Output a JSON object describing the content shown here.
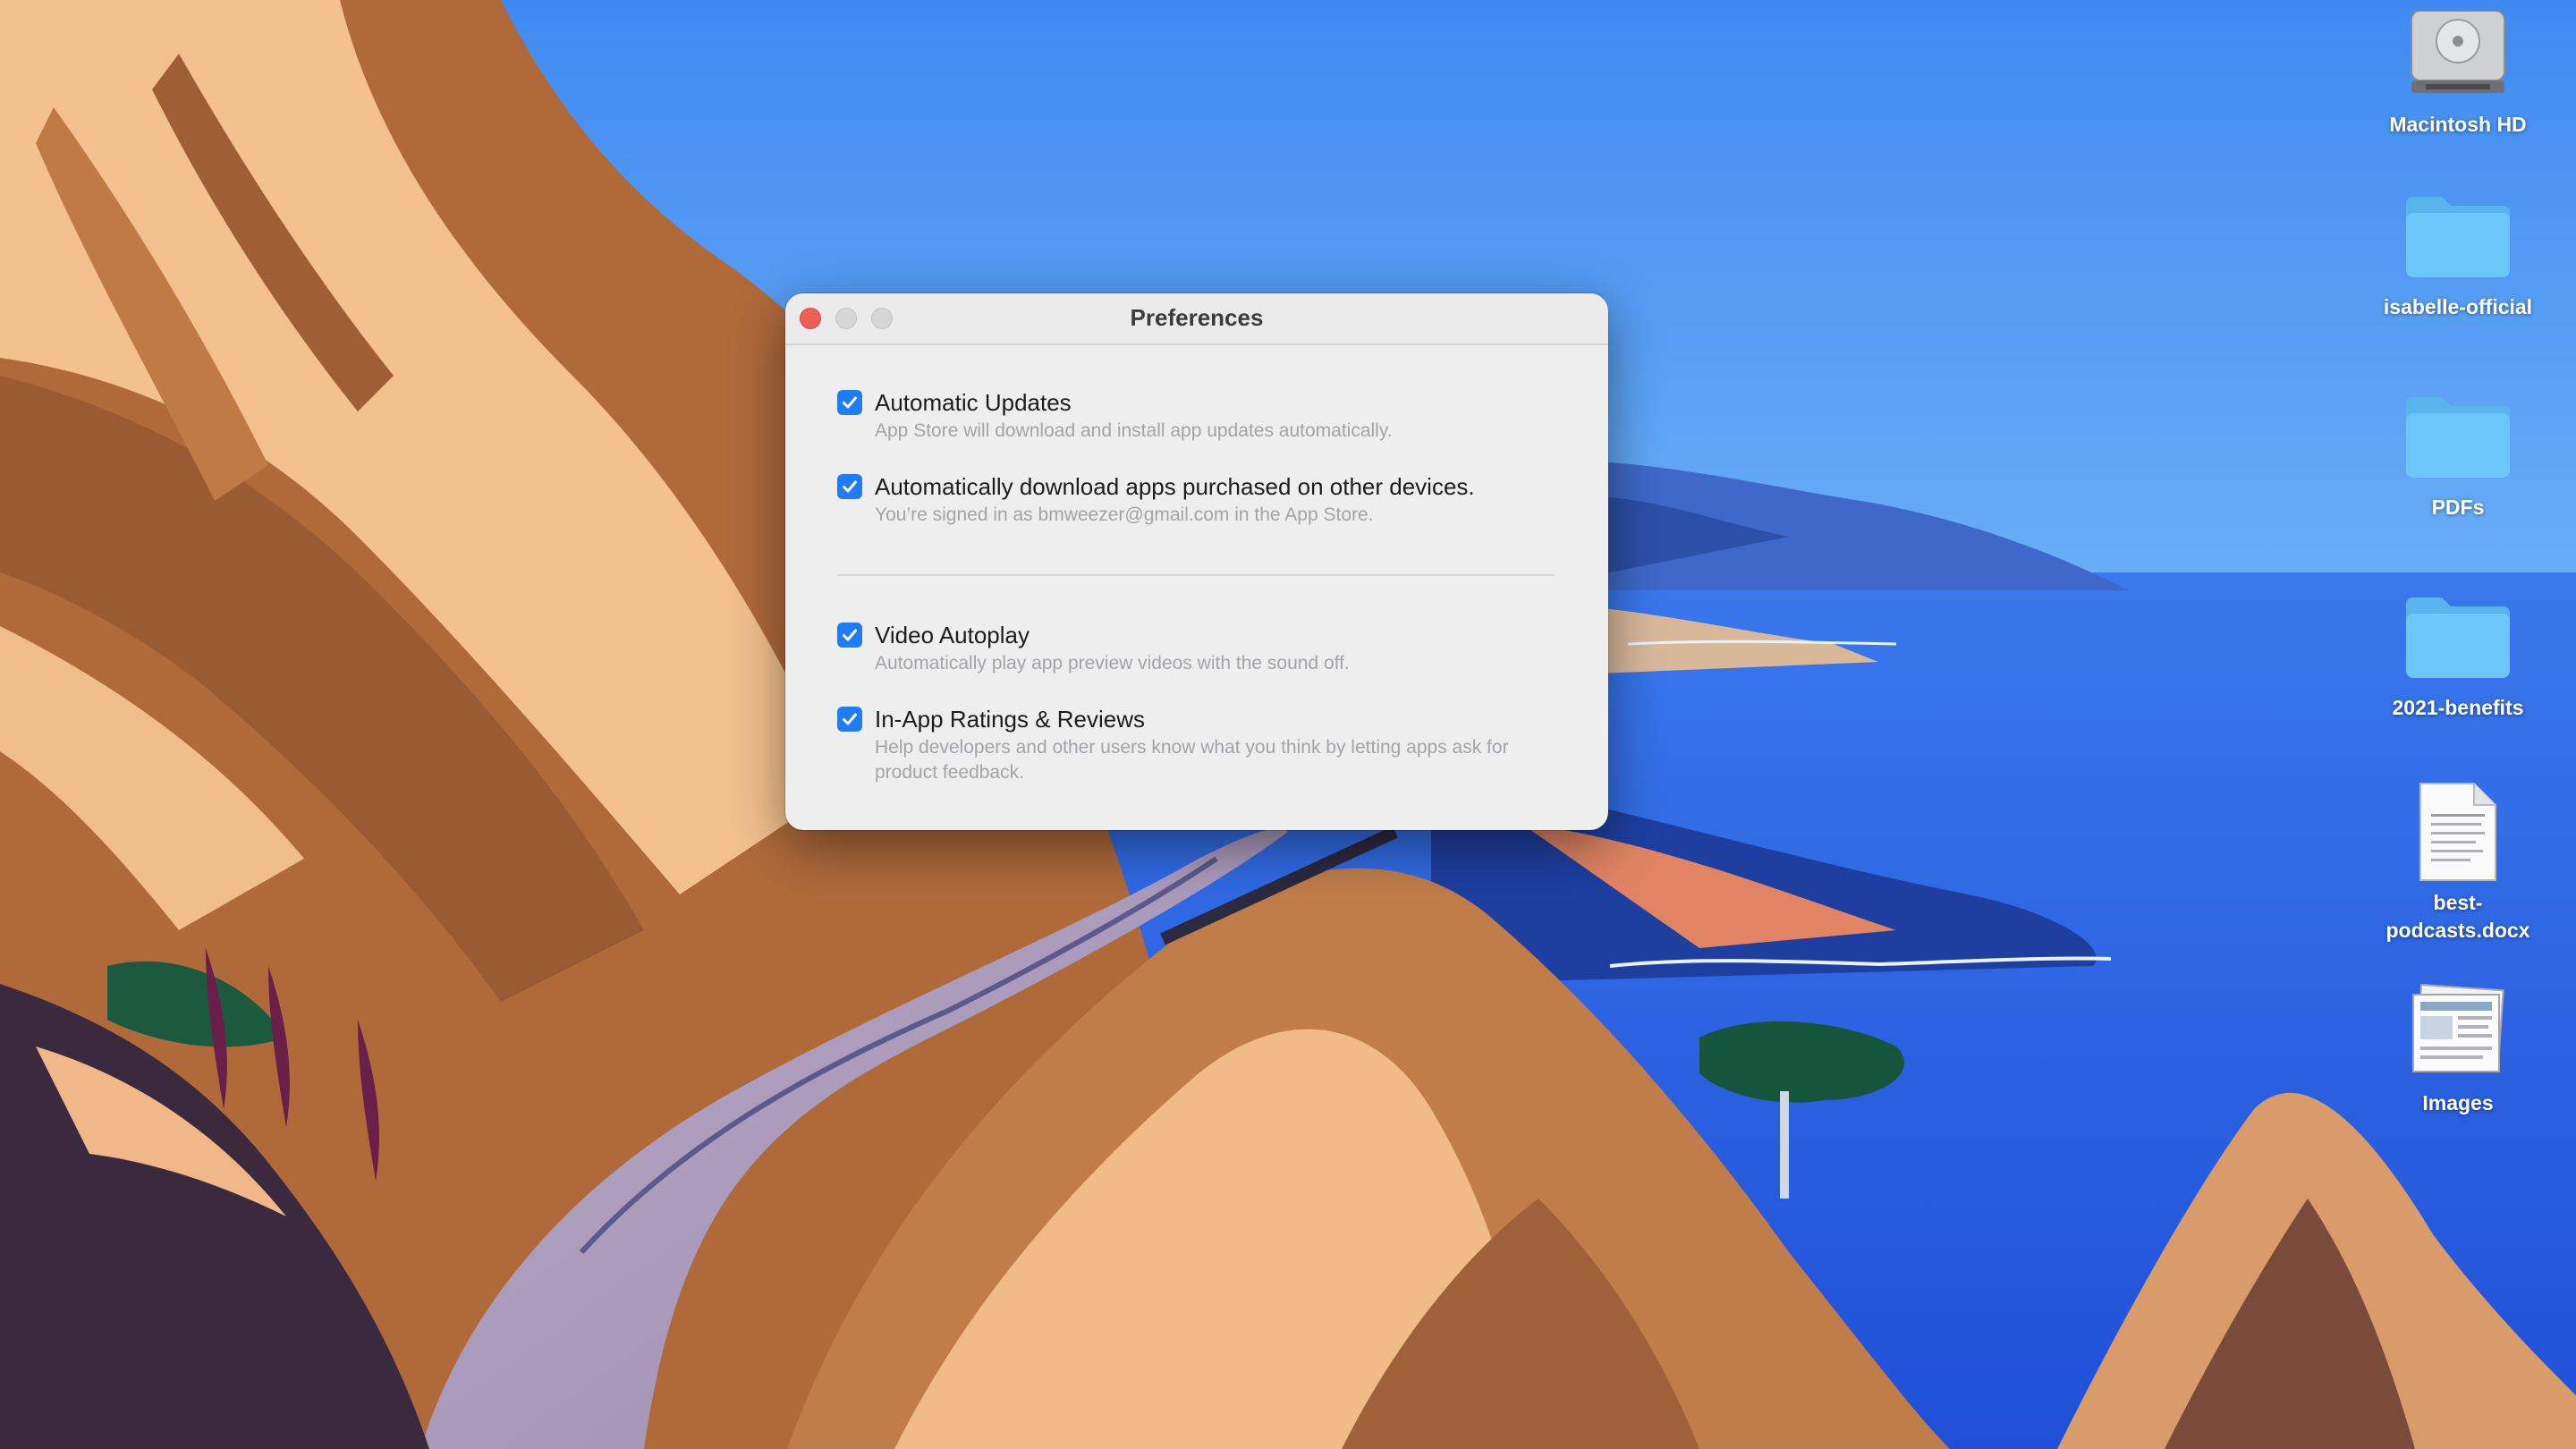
{
  "window": {
    "title": "Preferences"
  },
  "options": [
    {
      "label": "Automatic Updates",
      "description": "App Store will download and install app updates automatically.",
      "checked": true
    },
    {
      "label": "Automatically download apps purchased on other devices.",
      "description": "You’re signed in as bmweezer@gmail.com in the App Store.",
      "checked": true
    },
    {
      "label": "Video Autoplay",
      "description": "Automatically play app preview videos with the sound off.",
      "checked": true
    },
    {
      "label": "In-App Ratings & Reviews",
      "description": "Help developers and other users know what you think by letting apps ask for product feedback.",
      "checked": true
    }
  ],
  "desktop_icons": [
    {
      "label": "Macintosh HD",
      "icon": "hard-drive-icon"
    },
    {
      "label": "isabelle-official",
      "icon": "folder-icon"
    },
    {
      "label": "PDFs",
      "icon": "folder-icon"
    },
    {
      "label": "2021-benefits",
      "icon": "folder-icon"
    },
    {
      "label": "best-\npodcasts.docx",
      "icon": "document-icon"
    },
    {
      "label": "Images",
      "icon": "image-stack-icon"
    }
  ],
  "colors": {
    "accent": "#1f7cf4",
    "close": "#ee5f57",
    "folder": "#6cc6f8"
  }
}
